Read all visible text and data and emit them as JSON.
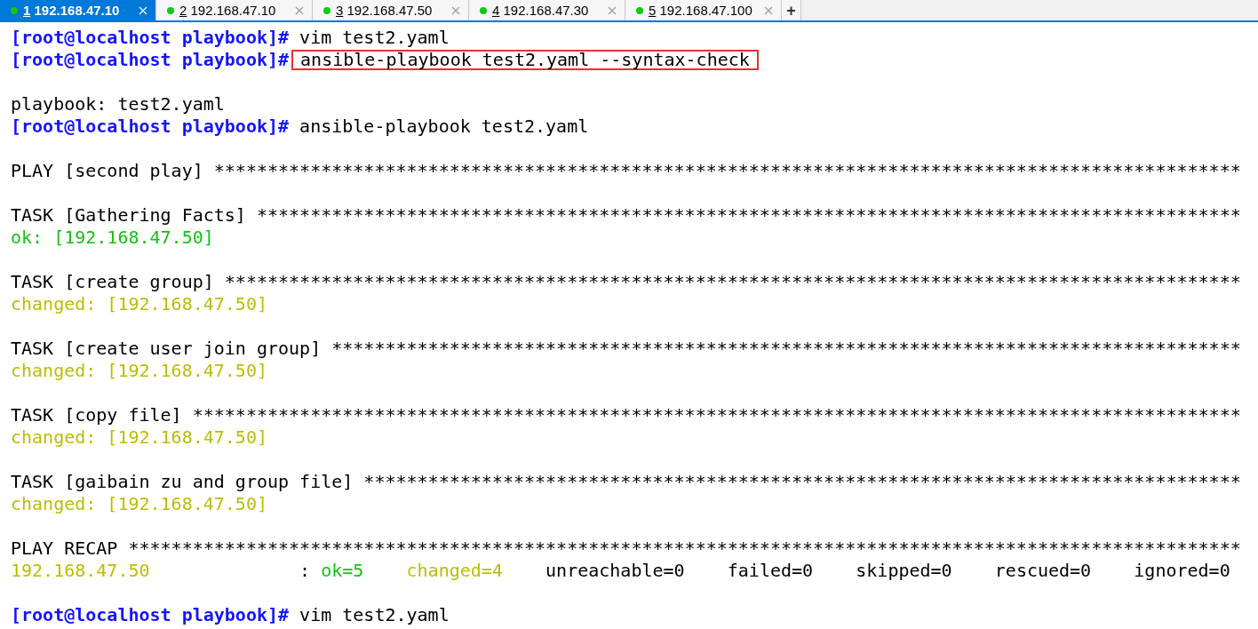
{
  "tabs": [
    {
      "number": "1",
      "host": "192.168.47.10",
      "selected": true
    },
    {
      "number": "2",
      "host": "192.168.47.10",
      "selected": false
    },
    {
      "number": "3",
      "host": "192.168.47.50",
      "selected": false
    },
    {
      "number": "4",
      "host": "192.168.47.30",
      "selected": false
    },
    {
      "number": "5",
      "host": "192.168.47.100",
      "selected": false
    }
  ],
  "new_tab": "+",
  "terminal": {
    "blocks": [
      {
        "lines": [
          [
            {
              "kind": "prompt",
              "text": "[root@localhost playbook]#"
            },
            {
              "kind": "plain",
              "text": " vim test2.yaml"
            }
          ],
          [
            {
              "kind": "prompt",
              "text": "[root@localhost playbook]#"
            },
            {
              "kind": "highlight",
              "text": "ansible-playbook test2.yaml --syntax-check"
            }
          ]
        ]
      },
      {
        "lines": [
          [
            {
              "kind": "plain",
              "text": "playbook: test2.yaml"
            }
          ],
          [
            {
              "kind": "prompt",
              "text": "[root@localhost playbook]#"
            },
            {
              "kind": "plain",
              "text": " ansible-playbook test2.yaml"
            }
          ]
        ]
      },
      {
        "lines": [
          [
            {
              "kind": "plain",
              "text": "PLAY [second play] ************************************************************************************************"
            }
          ]
        ]
      },
      {
        "lines": [
          [
            {
              "kind": "plain",
              "text": "TASK [Gathering Facts] ********************************************************************************************"
            }
          ],
          [
            {
              "kind": "ok",
              "text": "ok: [192.168.47.50]"
            }
          ]
        ]
      },
      {
        "lines": [
          [
            {
              "kind": "plain",
              "text": "TASK [create group] ***********************************************************************************************"
            }
          ],
          [
            {
              "kind": "changed",
              "text": "changed: [192.168.47.50]"
            }
          ]
        ]
      },
      {
        "lines": [
          [
            {
              "kind": "plain",
              "text": "TASK [create user join group] *************************************************************************************"
            }
          ],
          [
            {
              "kind": "changed",
              "text": "changed: [192.168.47.50]"
            }
          ]
        ]
      },
      {
        "lines": [
          [
            {
              "kind": "plain",
              "text": "TASK [copy file] **************************************************************************************************"
            }
          ],
          [
            {
              "kind": "changed",
              "text": "changed: [192.168.47.50]"
            }
          ]
        ]
      },
      {
        "lines": [
          [
            {
              "kind": "plain",
              "text": "TASK [gaibain zu and group file] **********************************************************************************"
            }
          ],
          [
            {
              "kind": "changed",
              "text": "changed: [192.168.47.50]"
            }
          ]
        ]
      },
      {
        "lines": [
          [
            {
              "kind": "plain",
              "text": "PLAY RECAP ********************************************************************************************************"
            }
          ],
          [
            {
              "kind": "changed",
              "text": "192.168.47.50"
            },
            {
              "kind": "plain",
              "text": "              : "
            },
            {
              "kind": "ok",
              "text": "ok=5"
            },
            {
              "kind": "changed",
              "text": "changed=4",
              "gap_before": true
            },
            {
              "kind": "plain",
              "text": "    unreachable=0    failed=0    skipped=0    rescued=0    ignored=0"
            }
          ]
        ]
      },
      {
        "lines": [
          [
            {
              "kind": "prompt",
              "text": "[root@localhost playbook]#"
            },
            {
              "kind": "plain",
              "text": " vim test2.yaml"
            }
          ]
        ]
      }
    ]
  }
}
